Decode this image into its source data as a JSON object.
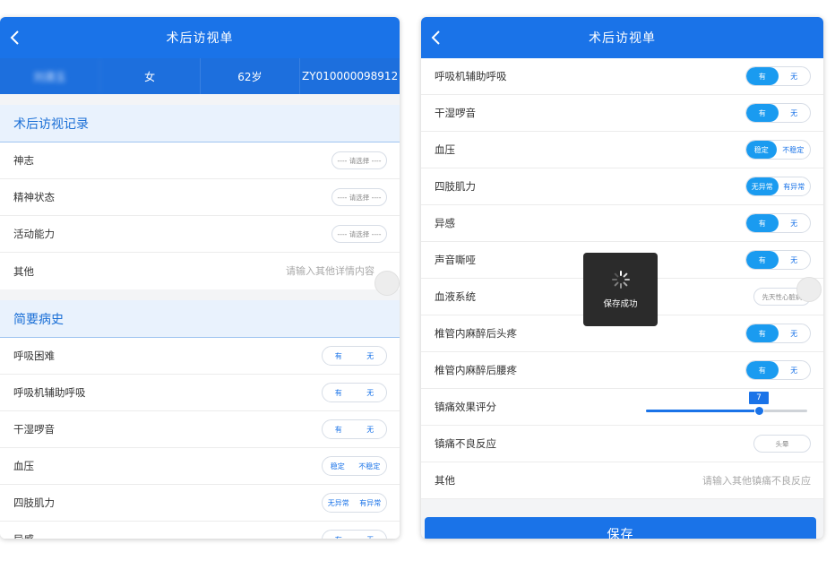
{
  "left": {
    "title": "术后访视单",
    "patient": {
      "name": "刘清玉",
      "gender": "女",
      "age": "62岁",
      "id": "ZY010000098912"
    },
    "section1": {
      "title": "术后访视记录",
      "rows": [
        {
          "label": "神志",
          "placeholder": "---- 请选择 ----"
        },
        {
          "label": "精神状态",
          "placeholder": "---- 请选择 ----"
        },
        {
          "label": "活动能力",
          "placeholder": "---- 请选择 ----"
        }
      ],
      "other": {
        "label": "其他",
        "placeholder": "请输入其他详情内容"
      }
    },
    "section2": {
      "title": "简要病史",
      "rows": [
        {
          "label": "呼吸困难",
          "a": "有",
          "b": "无"
        },
        {
          "label": "呼吸机辅助呼吸",
          "a": "有",
          "b": "无"
        },
        {
          "label": "干湿啰音",
          "a": "有",
          "b": "无"
        },
        {
          "label": "血压",
          "a": "稳定",
          "b": "不稳定"
        },
        {
          "label": "四肢肌力",
          "a": "无异常",
          "b": "有异常"
        },
        {
          "label": "异感",
          "a": "有",
          "b": "无"
        }
      ]
    }
  },
  "right": {
    "title": "术后访视单",
    "rows": [
      {
        "label": "呼吸机辅助呼吸",
        "a": "有",
        "b": "无"
      },
      {
        "label": "干湿啰音",
        "a": "有",
        "b": "无"
      },
      {
        "label": "血压",
        "a": "稳定",
        "b": "不稳定"
      },
      {
        "label": "四肢肌力",
        "a": "无异常",
        "b": "有异常"
      },
      {
        "label": "异感",
        "a": "有",
        "b": "无"
      },
      {
        "label": "声音嘶哑",
        "a": "有",
        "b": "无"
      }
    ],
    "blood": {
      "label": "血液系统",
      "value": "先天性心脏病"
    },
    "rows2": [
      {
        "label": "椎管内麻醉后头疼",
        "a": "有",
        "b": "无"
      },
      {
        "label": "椎管内麻醉后腰疼",
        "a": "有",
        "b": "无"
      }
    ],
    "pain_score": {
      "label": "镇痛效果评分",
      "value": "7",
      "fraction": 0.7
    },
    "adverse": {
      "label": "镇痛不良反应",
      "value": "头晕"
    },
    "other": {
      "label": "其他",
      "placeholder": "请输入其他镇痛不良反应"
    },
    "save_label": "保存",
    "toast": "保存成功"
  },
  "colors": {
    "primary": "#1a73e8",
    "accent": "#1a9bf0"
  }
}
